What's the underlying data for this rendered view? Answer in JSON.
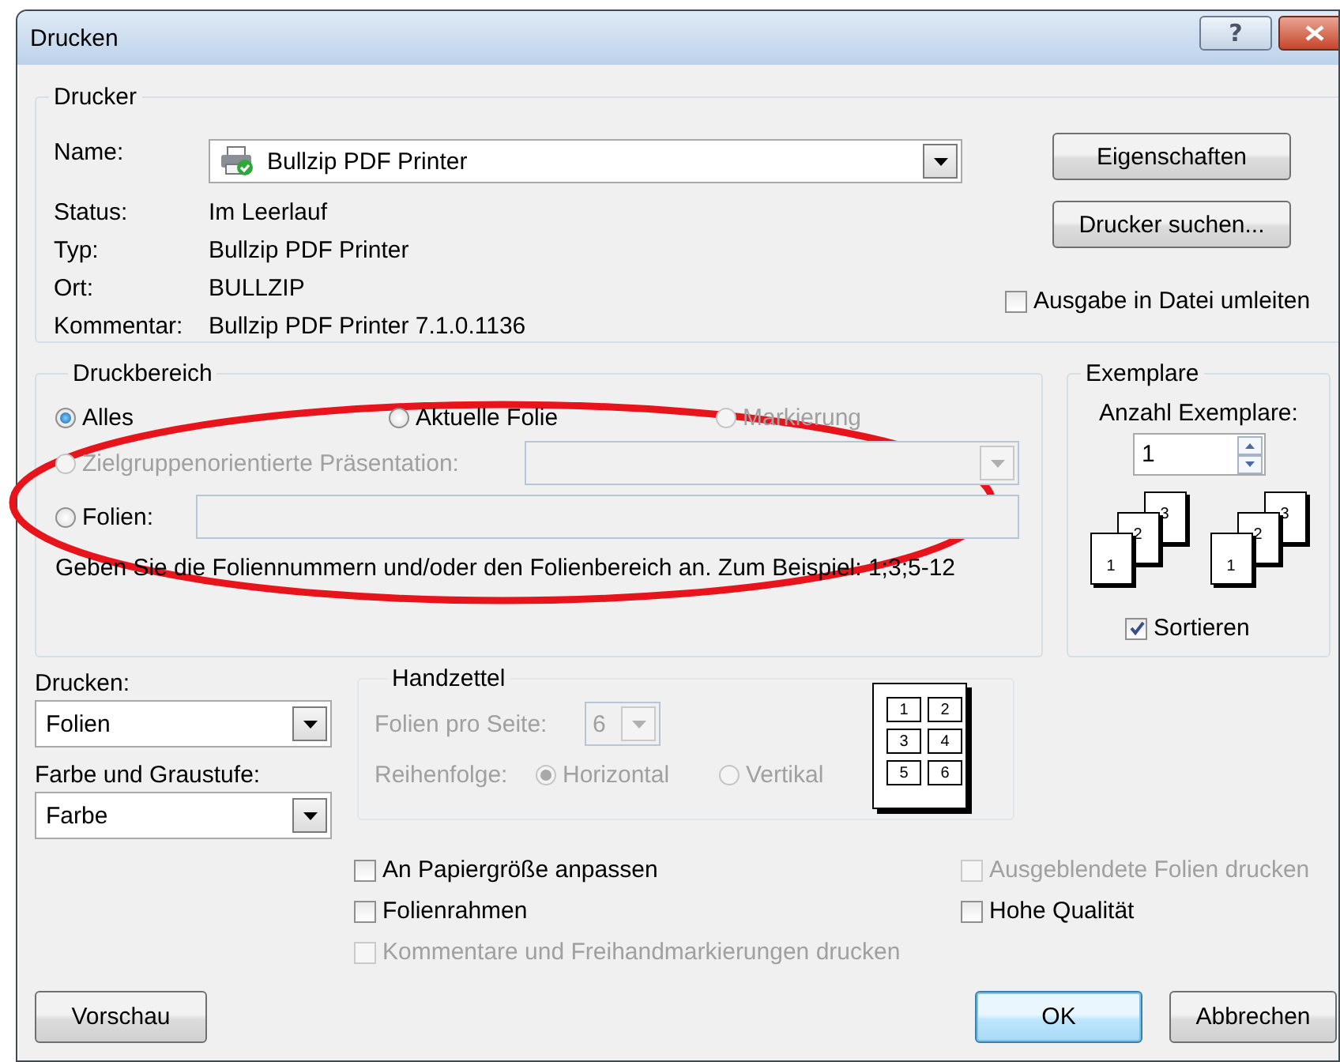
{
  "window": {
    "title": "Drucken",
    "help_label": "?"
  },
  "printer": {
    "legend": "Drucker",
    "name_label": "Name:",
    "name_value": "Bullzip PDF Printer",
    "info": [
      {
        "label": "Status:",
        "value": "Im Leerlauf"
      },
      {
        "label": "Typ:",
        "value": "Bullzip PDF Printer"
      },
      {
        "label": "Ort:",
        "value": "BULLZIP"
      },
      {
        "label": "Kommentar:",
        "value": "Bullzip PDF Printer 7.1.0.1136"
      }
    ],
    "buttons": [
      "Eigenschaften",
      "Drucker suchen..."
    ],
    "print_to_file": {
      "label": "Ausgabe in Datei umleiten",
      "checked": false
    }
  },
  "range": {
    "legend": "Druckbereich",
    "options": [
      {
        "kind": "plain",
        "label": "Alles",
        "selected": true,
        "disabled": false
      },
      {
        "kind": "plain",
        "label": "Aktuelle Folie",
        "selected": false,
        "disabled": false
      },
      {
        "kind": "plain",
        "label": "Markierung",
        "selected": false,
        "disabled": true
      },
      {
        "kind": "combo",
        "label": "Zielgruppenorientierte Präsentation:",
        "selected": false,
        "disabled": true
      },
      {
        "kind": "field",
        "label": "Folien:",
        "selected": false,
        "disabled": false
      }
    ],
    "hint": "Geben Sie die Foliennummern und/oder den Folienbereich an. Zum Beispiel: 1;3;5-12"
  },
  "copies": {
    "legend": "Exemplare",
    "count_label": "Anzahl Exemplare:",
    "count": "1",
    "stacks": [
      [
        "1",
        "2",
        "3"
      ],
      [
        "1",
        "2",
        "3"
      ]
    ],
    "collate": {
      "label": "Sortieren",
      "checked": true
    }
  },
  "print_what": {
    "label": "Drucken:",
    "value": "Folien"
  },
  "color_mode": {
    "label": "Farbe und Graustufe:",
    "value": "Farbe"
  },
  "handout": {
    "legend": "Handzettel",
    "disabled": true,
    "per_page_label": "Folien pro Seite:",
    "per_page": "6",
    "order_label": "Reihenfolge:",
    "orders": [
      {
        "label": "Horizontal",
        "selected": true
      },
      {
        "label": "Vertikal",
        "selected": false
      }
    ],
    "preview": [
      "1",
      "2",
      "3",
      "4",
      "5",
      "6"
    ]
  },
  "options": [
    {
      "label": "An Papiergröße anpassen",
      "checked": false,
      "disabled": false
    },
    {
      "label": "Ausgeblendete Folien drucken",
      "checked": false,
      "disabled": true
    },
    {
      "label": "Folienrahmen",
      "checked": false,
      "disabled": false
    },
    {
      "label": "Hohe Qualität",
      "checked": false,
      "disabled": false
    },
    {
      "label": "Kommentare und Freihandmarkierungen drucken",
      "checked": false,
      "disabled": true
    }
  ],
  "buttons": [
    {
      "label": "Vorschau",
      "default": false
    },
    {
      "label": "OK",
      "default": true
    },
    {
      "label": "Abbrechen",
      "default": false
    }
  ],
  "annotation": {
    "kind": "ellipse"
  }
}
